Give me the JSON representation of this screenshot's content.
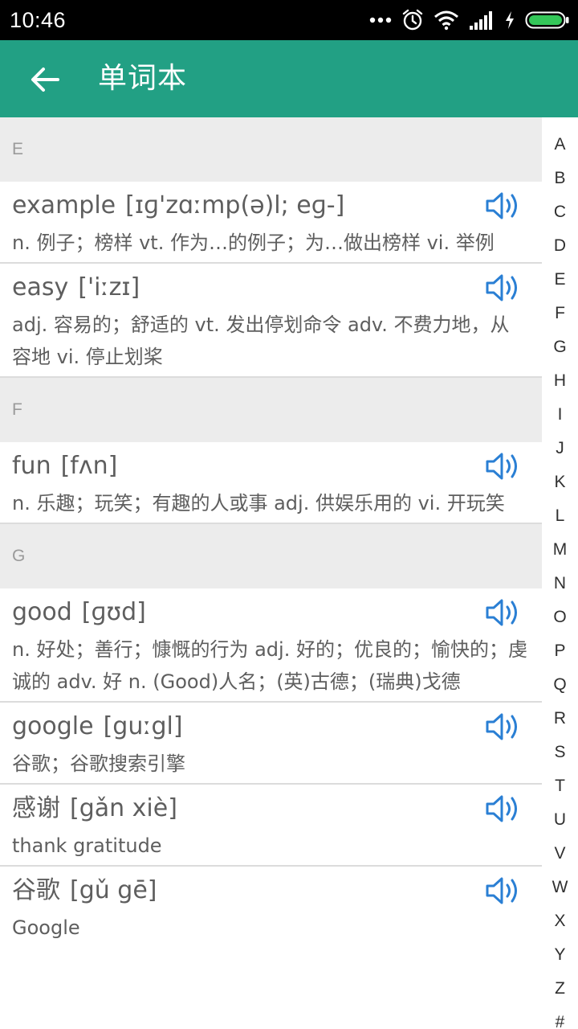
{
  "status_bar": {
    "time": "10:46",
    "icons": [
      "more-dots-icon",
      "alarm-icon",
      "wifi-icon",
      "signal-icon",
      "charging-bolt-icon",
      "battery-icon"
    ]
  },
  "app_bar": {
    "title": "单词本",
    "back_icon": "arrow-left-icon",
    "color": "#22a084"
  },
  "sections": [
    {
      "letter": "E",
      "entries": [
        {
          "word": "example",
          "phonetic": "[ɪɡ'zɑːmp(ə)l; eɡ-]",
          "definition": "n. 例子；榜样 vt. 作为…的例子；为…做出榜样 vi. 举例"
        },
        {
          "word": "easy",
          "phonetic": "['iːzɪ]",
          "definition": "adj. 容易的；舒适的 vt. 发出停划命令 adv. 不费力地，从容地 vi. 停止划桨"
        }
      ]
    },
    {
      "letter": "F",
      "entries": [
        {
          "word": "fun",
          "phonetic": "[fʌn]",
          "definition": "n. 乐趣；玩笑；有趣的人或事 adj. 供娱乐用的 vi. 开玩笑"
        }
      ]
    },
    {
      "letter": "G",
      "entries": [
        {
          "word": "good",
          "phonetic": "[ɡʊd]",
          "definition": "n. 好处；善行；慷慨的行为 adj. 好的；优良的；愉快的；虔诚的 adv. 好 n. (Good)人名；(英)古德；(瑞典)戈德"
        },
        {
          "word": "google",
          "phonetic": "[guːgl]",
          "definition": "谷歌；谷歌搜索引擎"
        },
        {
          "word": "感谢",
          "phonetic": "[gǎn xiè]",
          "definition": "thank gratitude"
        },
        {
          "word": "谷歌",
          "phonetic": "[gǔ gē]",
          "definition": "Google"
        }
      ]
    }
  ],
  "speaker_icon": "speaker-icon",
  "speaker_color": "#2a7fd4",
  "alpha_index": [
    "A",
    "B",
    "C",
    "D",
    "E",
    "F",
    "G",
    "H",
    "I",
    "J",
    "K",
    "L",
    "M",
    "N",
    "O",
    "P",
    "Q",
    "R",
    "S",
    "T",
    "U",
    "V",
    "W",
    "X",
    "Y",
    "Z",
    "#"
  ]
}
